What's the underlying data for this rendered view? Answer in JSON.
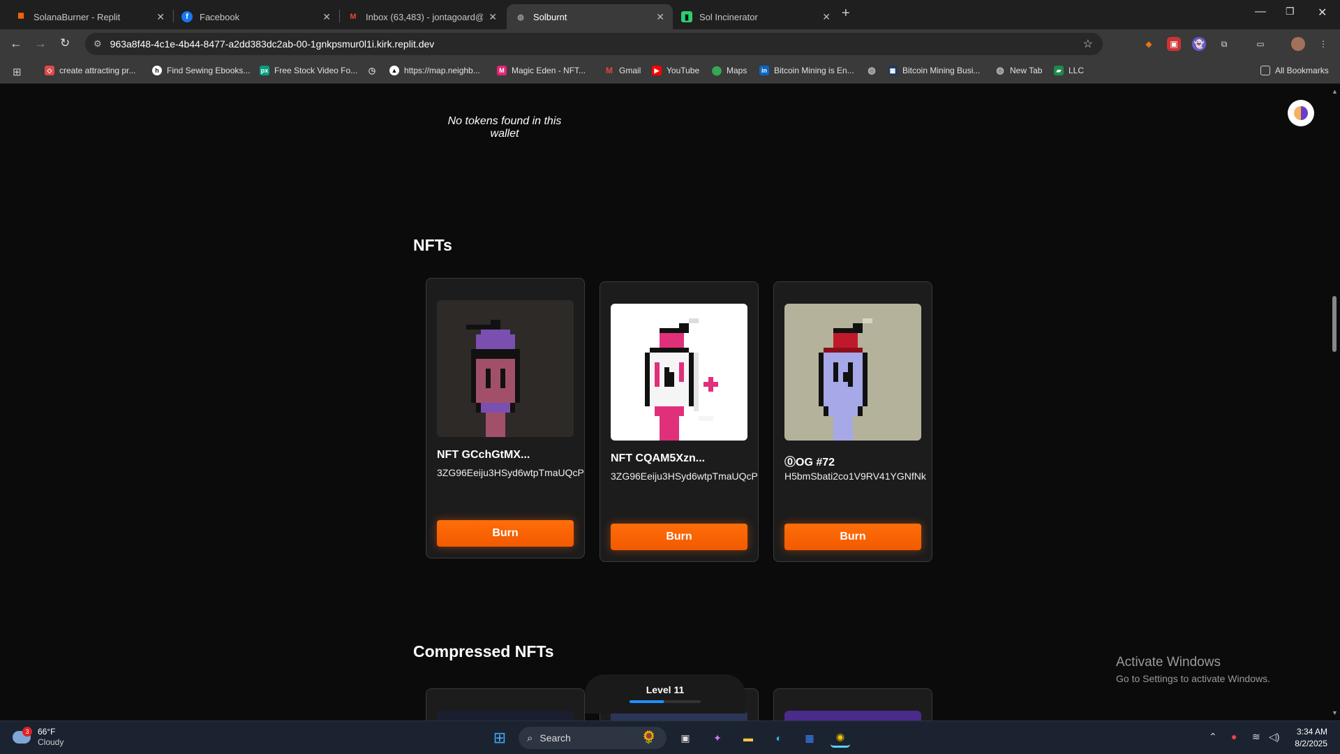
{
  "browser": {
    "tabs": [
      {
        "title": "SolanaBurner - Replit",
        "icon": "replit-icon",
        "color": "#f26207"
      },
      {
        "title": "Facebook",
        "icon": "facebook-icon",
        "color": "#1877f2"
      },
      {
        "title": "Inbox (63,483) - jontagoard@g",
        "icon": "gmail-icon",
        "color": "#ea4335"
      },
      {
        "title": "Solburnt",
        "icon": "globe-icon",
        "color": "#8a8a8a"
      },
      {
        "title": "Sol Incinerator",
        "icon": "sol-incinerator-icon",
        "color": "#2ecc71"
      }
    ],
    "url": "963a8f48-4c1e-4b44-8477-a2dd383dc2ab-00-1gnkpsmur0l1i.kirk.replit.dev",
    "bookmarks": [
      {
        "label": "create attracting pr...",
        "color": "#e04a4a"
      },
      {
        "label": "Find Sewing Ebooks...",
        "color": "#444444"
      },
      {
        "label": "Free Stock Video Fo...",
        "color": "#05a081"
      },
      {
        "label": "",
        "color": "#666666"
      },
      {
        "label": "https://map.neighb...",
        "color": "#222222"
      },
      {
        "label": "Magic Eden - NFT...",
        "color": "#e42575"
      },
      {
        "label": "Gmail",
        "color": "#ea4335"
      },
      {
        "label": "YouTube",
        "color": "#ff0000"
      },
      {
        "label": "Maps",
        "color": "#34a853"
      },
      {
        "label": "Bitcoin Mining is En...",
        "color": "#0a66c2"
      },
      {
        "label": "",
        "color": "#777777"
      },
      {
        "label": "Bitcoin Mining Busi...",
        "color": "#1e3a5f"
      },
      {
        "label": "New Tab",
        "color": "#777777"
      },
      {
        "label": "LLC",
        "color": "#1a8d4a"
      }
    ],
    "all_bookmarks": "All Bookmarks"
  },
  "page": {
    "no_tokens": "No tokens found in this wallet",
    "nfts_title": "NFTs",
    "compressed_title": "Compressed NFTs",
    "nfts": [
      {
        "name": "NFT GCchGtMX...",
        "mint": "3ZG96Eeiju3HSyd6wtpTmaUQcP",
        "burn": "Burn"
      },
      {
        "name": "NFT CQAM5Xzn...",
        "mint": "3ZG96Eeiju3HSyd6wtpTmaUQcP",
        "burn": "Burn"
      },
      {
        "name": "🄋OG #72",
        "mint": "H5bmSbati2co1V9RV41YGNfNk",
        "burn": "Burn"
      }
    ],
    "level": {
      "label": "Level 11",
      "progress": 0.48
    }
  },
  "windows": {
    "activate_title": "Activate Windows",
    "activate_sub": "Go to Settings to activate Windows."
  },
  "taskbar": {
    "weather_temp": "66°F",
    "weather_cond": "Cloudy",
    "weather_badge": "3",
    "search_placeholder": "Search",
    "time": "3:34 AM",
    "date": "8/2/2025"
  }
}
